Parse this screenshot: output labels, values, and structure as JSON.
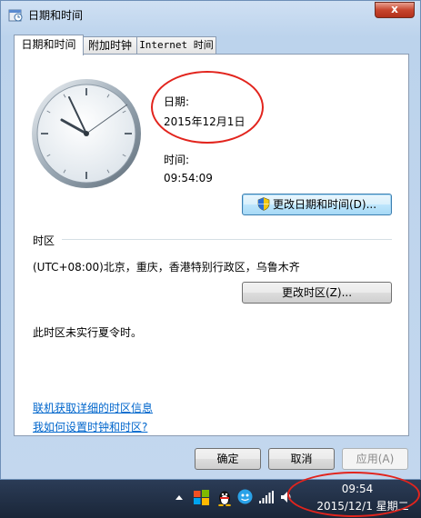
{
  "window": {
    "title": "日期和时间",
    "close_glyph": "x"
  },
  "tabs": [
    {
      "label": "日期和时间"
    },
    {
      "label": "附加时钟"
    },
    {
      "label": "Internet 时间"
    }
  ],
  "date": {
    "label": "日期:",
    "value": "2015年12月1日"
  },
  "time": {
    "label": "时间:",
    "value": "09:54:09"
  },
  "buttons": {
    "change_datetime": "更改日期和时间(D)...",
    "change_timezone": "更改时区(Z)...",
    "ok": "确定",
    "cancel": "取消",
    "apply": "应用(A)"
  },
  "timezone": {
    "section_label": "时区",
    "value": "(UTC+08:00)北京，重庆，香港特别行政区，乌鲁木齐",
    "dst_note": "此时区未实行夏令时。"
  },
  "links": {
    "online_info": "联机获取详细的时区信息",
    "how_to": "我如何设置时钟和时区?"
  },
  "taskbar": {
    "clock_time": "09:54",
    "clock_date": "2015/12/1 星期二",
    "icons": [
      "show-hidden-arrow-icon",
      "windows-flag-icon",
      "qq-penguin-icon",
      "app-ball-icon",
      "network-signal-icon",
      "volume-icon"
    ]
  },
  "colors": {
    "annotation_red": "#e2241d",
    "link_blue": "#0066cc"
  }
}
